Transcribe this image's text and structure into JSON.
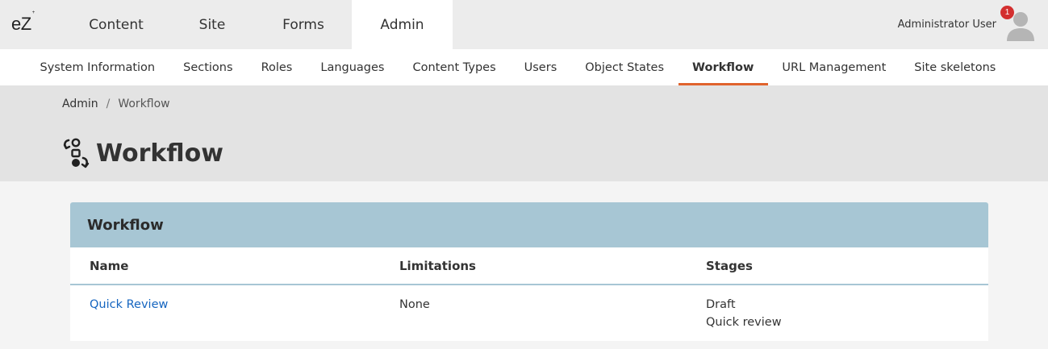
{
  "brand": {
    "logo": "eZ"
  },
  "mainnav": [
    {
      "label": "Content",
      "width": 132,
      "active": false
    },
    {
      "label": "Site",
      "width": 106,
      "active": false
    },
    {
      "label": "Forms",
      "width": 120,
      "active": false
    },
    {
      "label": "Admin",
      "width": 125,
      "active": true
    }
  ],
  "user": {
    "name": "Administrator User",
    "notifications": "1"
  },
  "subnav": [
    {
      "label": "System Information",
      "active": false
    },
    {
      "label": "Sections",
      "active": false
    },
    {
      "label": "Roles",
      "active": false
    },
    {
      "label": "Languages",
      "active": false
    },
    {
      "label": "Content Types",
      "active": false
    },
    {
      "label": "Users",
      "active": false
    },
    {
      "label": "Object States",
      "active": false
    },
    {
      "label": "Workflow",
      "active": true
    },
    {
      "label": "URL Management",
      "active": false
    },
    {
      "label": "Site skeletons",
      "active": false
    }
  ],
  "breadcrumb": {
    "root": "Admin",
    "separator": "/",
    "current": "Workflow"
  },
  "page": {
    "title": "Workflow"
  },
  "panel": {
    "title": "Workflow",
    "columns": {
      "name": "Name",
      "limitations": "Limitations",
      "stages": "Stages"
    },
    "rows": [
      {
        "name": "Quick Review",
        "limitations": "None",
        "stages": [
          "Draft",
          "Quick review"
        ]
      }
    ]
  },
  "colors": {
    "accent": "#e0632d",
    "panel_header": "#a7c6d4",
    "link": "#1565c0",
    "badge": "#d32f2f"
  }
}
